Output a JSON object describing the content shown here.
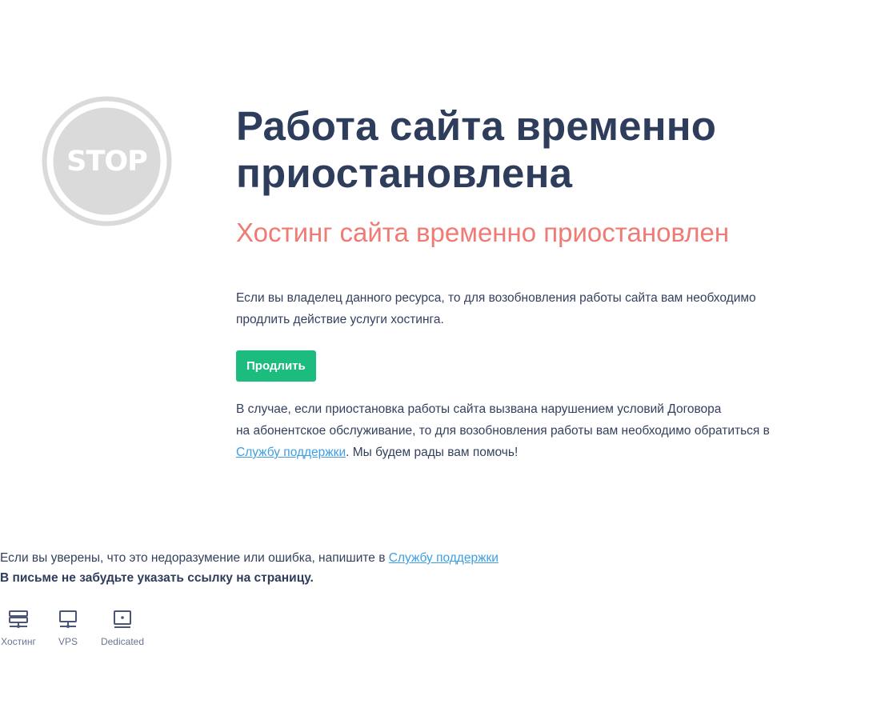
{
  "stop_sign": {
    "text": "STOP",
    "color": "#dadada"
  },
  "heading": {
    "title_line1": "Работа сайта временно",
    "title_line2": "приостановлена",
    "subtitle": "Хостинг сайта временно приостановлен"
  },
  "owner_notice": {
    "line1": "Если вы владелец данного ресурса, то для возобновления работы сайта вам необходимо",
    "line2": "продлить действие услуги хостинга."
  },
  "renew_button": {
    "label": "Продлить",
    "color": "#1cbc7e"
  },
  "violation_notice": {
    "line1": "В случае, если приостановка работы сайта вызвана нарушением условий Договора",
    "line2": "на абонентское обслуживание, то для возобновления работы вам необходимо обратиться в",
    "support_link": "Службу поддержки",
    "tail": ". Мы будем рады вам помочь!"
  },
  "footer": {
    "error_text": "Если вы уверены, что это недоразумение или ошибка, напишите в ",
    "support_link": "Службу поддержки",
    "bold_note": "В письме не забудьте указать ссылку на страницу."
  },
  "products": [
    {
      "label": "Хостинг",
      "icon": "hosting-icon"
    },
    {
      "label": "VPS",
      "icon": "vps-icon"
    },
    {
      "label": "Dedicated",
      "icon": "dedicated-icon"
    }
  ],
  "colors": {
    "title": "#2f3d5d",
    "subtitle": "#f07a74",
    "link": "#3d9ee4",
    "icon": "#4a5675"
  }
}
